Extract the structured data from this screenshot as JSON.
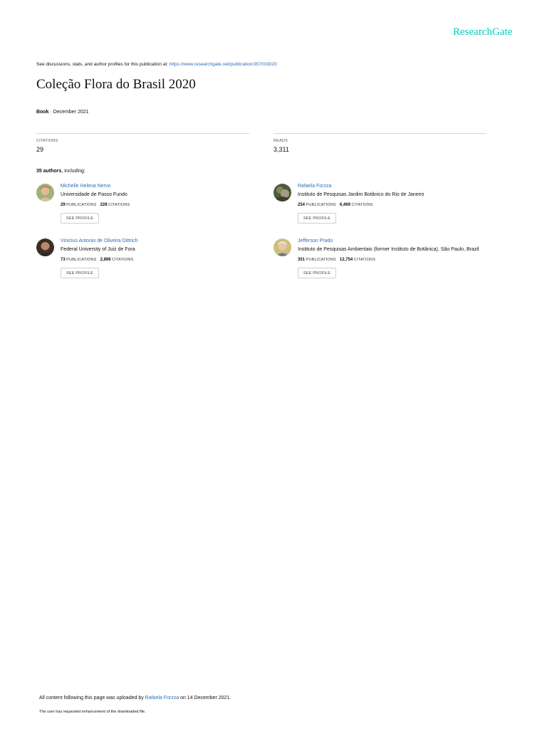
{
  "brand": {
    "name": "ResearchGate",
    "color": "#00ccbb"
  },
  "header": {
    "discuss_text": "See discussions, stats, and author profiles for this publication at: ",
    "discuss_link": "https://www.researchgate.net/publication/357033020"
  },
  "publication": {
    "title": "Coleção Flora do Brasil 2020",
    "type": "Book",
    "separator": " · ",
    "date": "December 2021"
  },
  "stats": {
    "citations_label": "CITATIONS",
    "citations_value": "29",
    "reads_label": "READS",
    "reads_value": "3,311"
  },
  "authors_summary": {
    "count_text": "35 authors",
    "suffix": ", including:"
  },
  "authors": [
    {
      "name": "Michelle Helena Nervo",
      "institution": "Universidade de Passo Fundo",
      "publications": "29",
      "publications_label": "PUBLICATIONS",
      "citations": "228",
      "citations_label": "CITATIONS",
      "button": "SEE PROFILE"
    },
    {
      "name": "Rafaela Forzza",
      "institution": "Instituto de Pesquisas Jardim Botânico do Rio de Janeiro",
      "publications": "254",
      "publications_label": "PUBLICATIONS",
      "citations": "6,469",
      "citations_label": "CITATIONS",
      "button": "SEE PROFILE"
    },
    {
      "name": "Vinicius Antonio de Oliveira Dittrich",
      "institution": "Federal University of Juiz de Fora",
      "publications": "73",
      "publications_label": "PUBLICATIONS",
      "citations": "2,896",
      "citations_label": "CITATIONS",
      "button": "SEE PROFILE"
    },
    {
      "name": "Jefferson Prado",
      "institution": "Instituto de Pesquisas Ambientais (former Instituto de Botânica), São Paulo, Brazil",
      "publications": "351",
      "publications_label": "PUBLICATIONS",
      "citations": "12,754",
      "citations_label": "CITATIONS",
      "button": "SEE PROFILE"
    }
  ],
  "footer": {
    "upload_prefix": "All content following this page was uploaded by ",
    "uploader": "Rafaela Forzza",
    "upload_suffix": " on 14 December 2021.",
    "note": "The user has requested enhancement of the downloaded file."
  }
}
